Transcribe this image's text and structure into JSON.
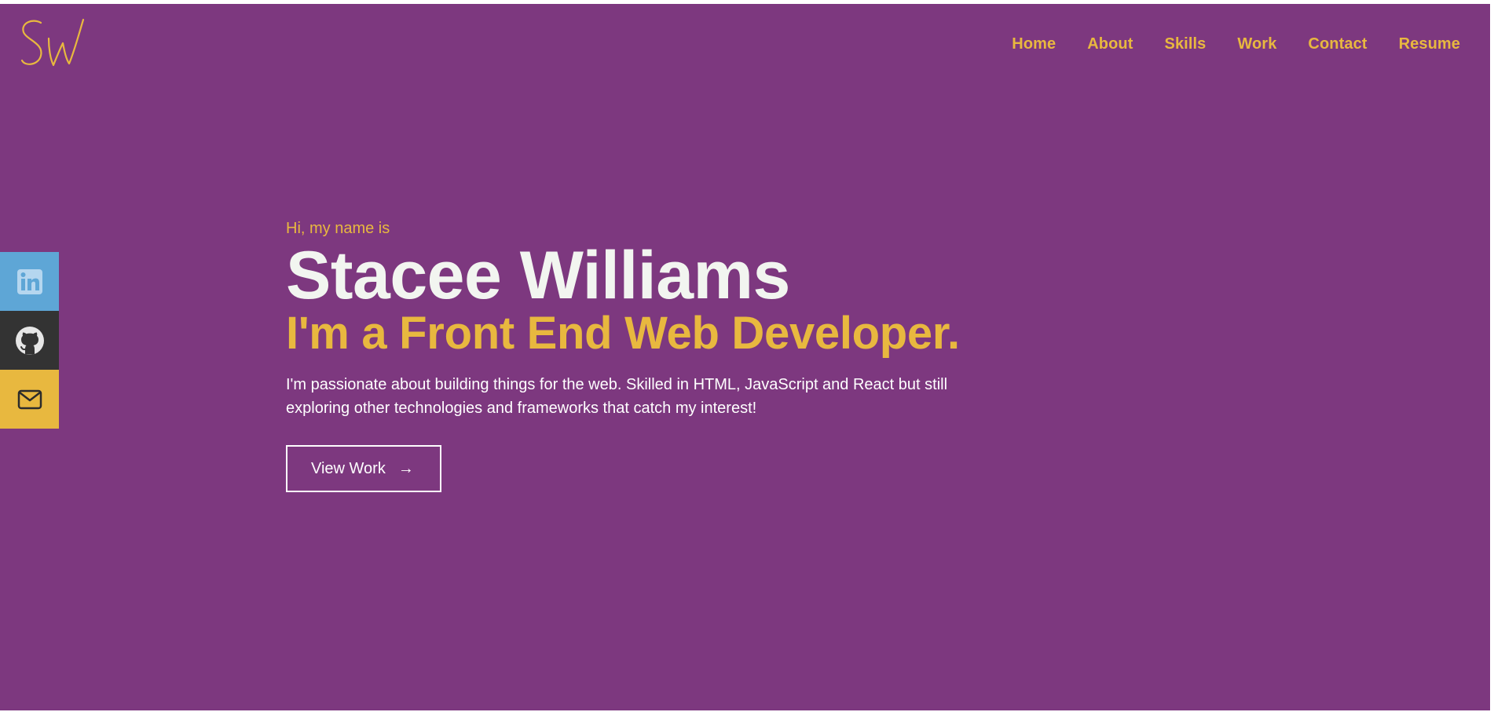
{
  "logo": {
    "text": "SW",
    "color": "#e8b83f"
  },
  "nav": {
    "items": [
      {
        "label": "Home"
      },
      {
        "label": "About"
      },
      {
        "label": "Skills"
      },
      {
        "label": "Work"
      },
      {
        "label": "Contact"
      },
      {
        "label": "Resume"
      }
    ]
  },
  "social": [
    {
      "icon": "linkedin-icon",
      "color": "#5ea6d6"
    },
    {
      "icon": "github-icon",
      "color": "#333333"
    },
    {
      "icon": "mail-icon",
      "color": "#e8b83f"
    }
  ],
  "hero": {
    "greeting": "Hi, my name is",
    "name": "Stacee Williams",
    "tagline": "I'm a Front End Web Developer.",
    "bio": "I'm passionate about building things for the web. Skilled in HTML, JavaScript and React but still exploring other technologies and frameworks that catch my interest!",
    "cta_label": "View Work",
    "cta_arrow": "→"
  },
  "colors": {
    "background": "#7d387f",
    "accent": "#e8b83f",
    "text": "#ffffff"
  }
}
